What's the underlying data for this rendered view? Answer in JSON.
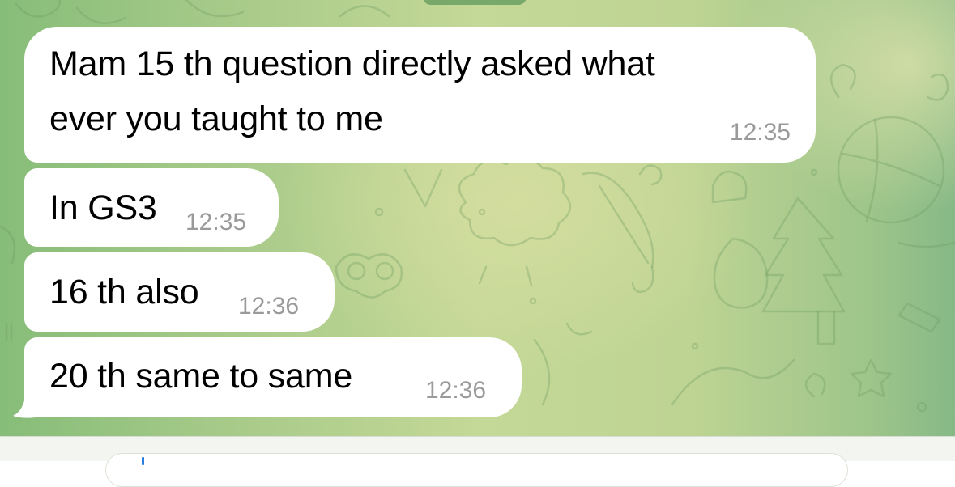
{
  "messages": [
    {
      "lines": [
        "Mam 15 th question directly asked what",
        "ever you taught to me"
      ],
      "time": "12:35"
    },
    {
      "text": "In GS3",
      "time": "12:35"
    },
    {
      "text": "16 th also",
      "time": "12:36"
    },
    {
      "text": "20 th same to same",
      "time": "12:36"
    }
  ],
  "colors": {
    "bubble": "#ffffff",
    "timestamp": "#9a9a9a",
    "background_green": "#a5c988",
    "caret": "#2a7ce0"
  }
}
